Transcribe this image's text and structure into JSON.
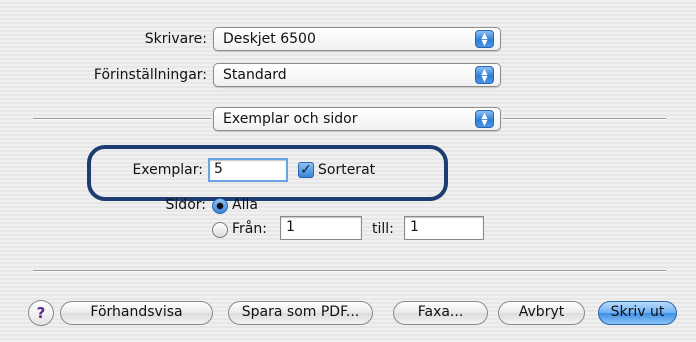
{
  "printer": {
    "label": "Skrivare:",
    "value": "Deskjet 6500"
  },
  "presets": {
    "label": "Förinställningar:",
    "value": "Standard"
  },
  "panel": {
    "value": "Exemplar och sidor"
  },
  "copies": {
    "label": "Exemplar:",
    "value": "5",
    "collate_label": "Sorterat",
    "collate_checked": true
  },
  "pages": {
    "label": "Sidor:",
    "all_label": "Alla",
    "from_label": "Från:",
    "from_value": "1",
    "to_label": "till:",
    "to_value": "1",
    "selected": "all"
  },
  "footer": {
    "help_icon": "?",
    "preview": "Förhandsvisa",
    "save_pdf": "Spara som PDF...",
    "fax": "Faxa...",
    "cancel": "Avbryt",
    "print": "Skriv ut"
  },
  "colors": {
    "accent": "#3a86dc",
    "highlight_frame": "#1d3c72"
  },
  "icons": {
    "popup_arrows": "updown-arrows-icon",
    "check": "checkmark-icon"
  }
}
